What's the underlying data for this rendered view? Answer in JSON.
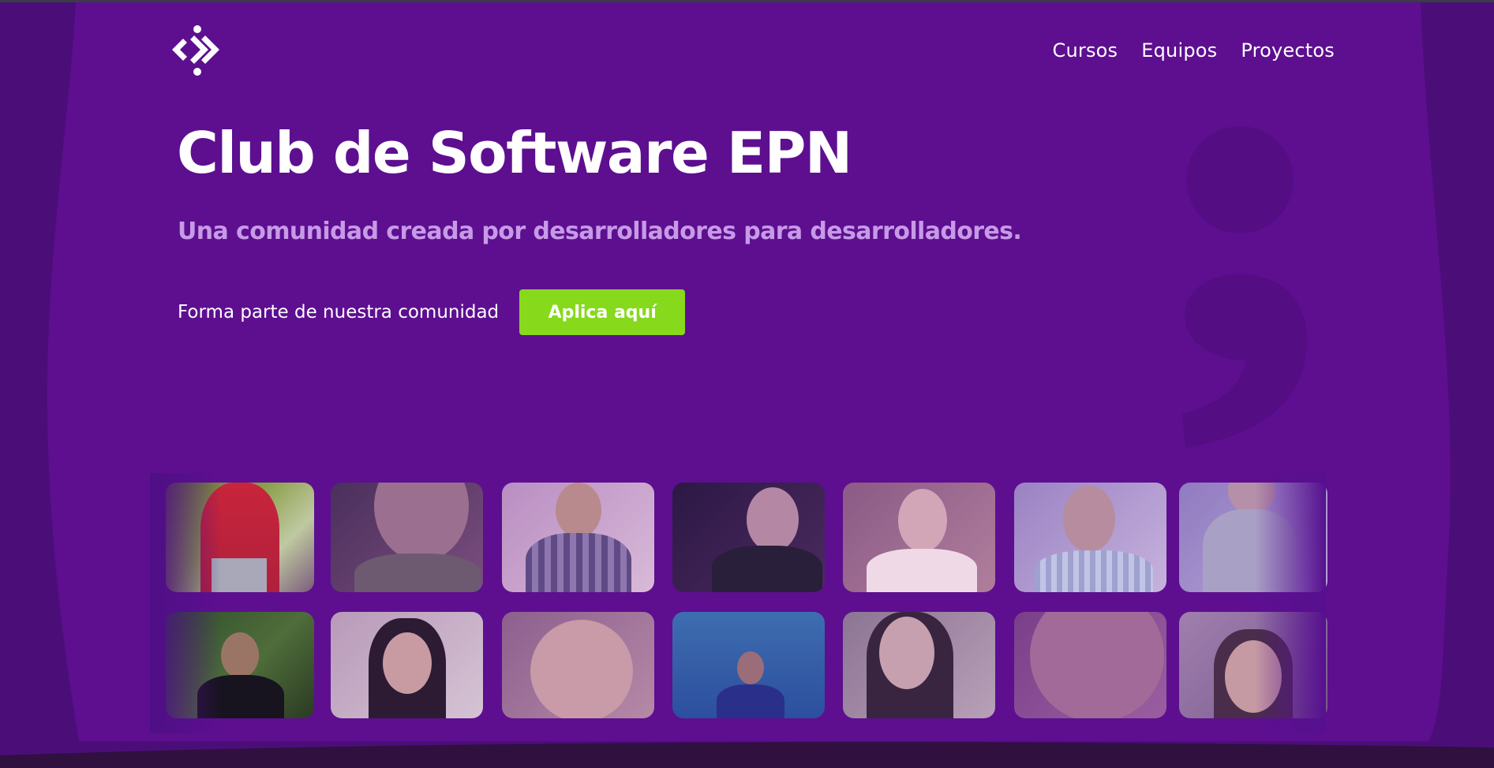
{
  "brand": {
    "logo_icon": "club-logo-icon"
  },
  "nav": {
    "items": [
      {
        "label": "Cursos"
      },
      {
        "label": "Equipos"
      },
      {
        "label": "Proyectos"
      }
    ]
  },
  "hero": {
    "title": "Club de Software EPN",
    "subtitle": "Una comunidad creada por desarrolladores para desarrolladores.",
    "cta_text": "Forma parte de nuestra comunidad",
    "cta_button": "Aplica aquí"
  },
  "decoration": {
    "glyph": ";"
  },
  "colors": {
    "background": "#5d0f90",
    "background_edge": "#4c0d78",
    "subtitle": "#c79ae7",
    "button": "#86d91b",
    "text": "#ffffff"
  },
  "gallery": {
    "rows": [
      [
        "member-photo",
        "member-photo",
        "member-photo",
        "member-photo",
        "member-photo",
        "member-photo",
        "member-photo"
      ],
      [
        "member-photo",
        "member-photo",
        "member-photo",
        "member-photo",
        "member-photo",
        "member-photo",
        "member-photo"
      ]
    ]
  }
}
